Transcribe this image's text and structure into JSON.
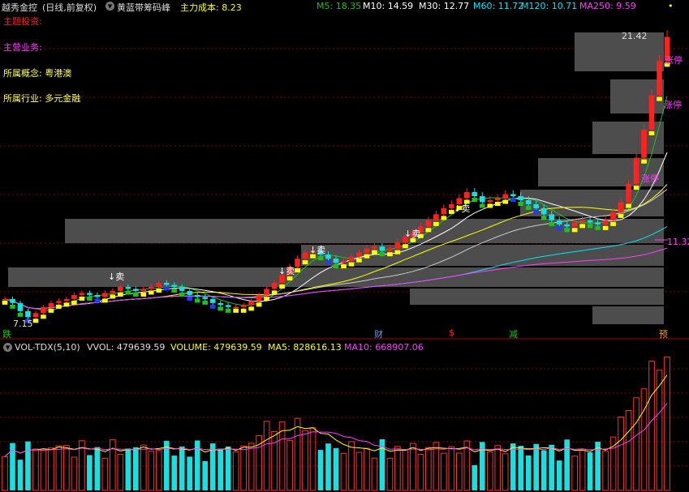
{
  "header": {
    "stock_name": "越秀金控",
    "period": "(日线,前复权)",
    "indicator_name": "黄蓝带筹码峰",
    "cost_label": "主力成本: 8.23",
    "ma5": "M5: 18.35",
    "ma10": "M10: 14.59",
    "ma30": "M30: 12.77",
    "ma60": "M60: 11.72",
    "ma120": "M120: 10.71",
    "ma250": "MA250: 9.59",
    "dot": "•",
    "colors": {
      "stock_name": "#dddddd",
      "indicator": "#dddddd",
      "cost": "#ffff00",
      "ma5": "#1fbf1f",
      "ma10": "#ffffff",
      "ma30": "#ffffff",
      "ma60": "#00e5ff",
      "ma120": "#00e5ff",
      "ma250": "#ff3cff"
    }
  },
  "info": {
    "theme_label": "主题投资:",
    "business_label": "主营业务:",
    "concept_label": "所属概念: 粤港澳",
    "industry_label": "所属行业: 多元金融"
  },
  "price_marks": {
    "high": "21.42",
    "low": "7.15",
    "right_value": "11.32",
    "limit_up_1": "涨停",
    "limit_up_2": "涨停",
    "limit_up_3": "涨停",
    "sell": "↓卖",
    "event_down": "跌",
    "event_cai": "财",
    "event_dollar": "$",
    "event_jian": "减",
    "event_yu": "预"
  },
  "volume_header": {
    "name": "VOL-TDX(5,10)",
    "vvol": "VVOL: 479639.59",
    "volume": "VOLUME: 479639.59",
    "ma5": "MA5: 828616.13",
    "ma10": "MA10: 668907.06"
  },
  "chart_data": {
    "type": "candlestick",
    "price_range": [
      7.15,
      21.42
    ],
    "closes": [
      8.2,
      8.0,
      7.6,
      7.3,
      7.5,
      7.8,
      8.0,
      8.1,
      8.2,
      8.4,
      8.5,
      8.4,
      8.3,
      8.5,
      8.6,
      8.8,
      8.7,
      8.6,
      8.7,
      8.8,
      9.0,
      8.9,
      8.8,
      8.6,
      8.4,
      8.3,
      8.2,
      8.0,
      7.9,
      7.8,
      7.8,
      7.9,
      8.1,
      8.4,
      8.7,
      9.0,
      9.4,
      9.8,
      10.2,
      10.5,
      10.6,
      10.4,
      10.2,
      10.0,
      10.1,
      10.3,
      10.5,
      10.7,
      10.8,
      10.6,
      10.7,
      11.0,
      11.3,
      11.5,
      11.8,
      12.1,
      12.4,
      12.7,
      12.9,
      13.2,
      13.5,
      13.3,
      13.0,
      13.1,
      13.2,
      13.4,
      13.3,
      13.1,
      12.9,
      12.7,
      12.4,
      12.1,
      11.9,
      11.8,
      12.0,
      12.1,
      12.0,
      11.9,
      12.1,
      12.5,
      13.0,
      13.9,
      15.2,
      16.6,
      18.3,
      20.0,
      21.2
    ],
    "volume_range": [
      0,
      1250000
    ]
  }
}
